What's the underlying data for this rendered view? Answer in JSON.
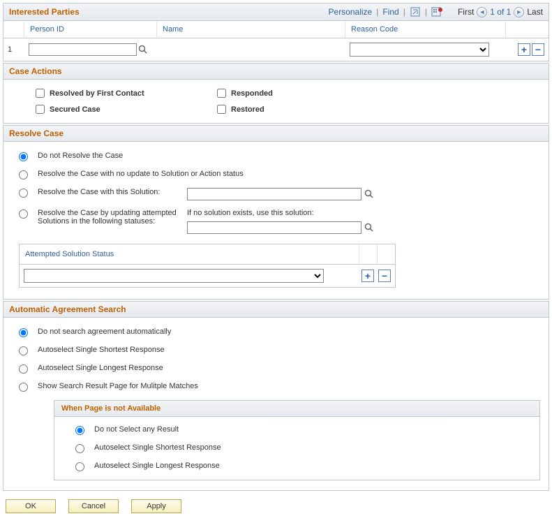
{
  "interestedParties": {
    "title": "Interested Parties",
    "tools": {
      "personalize": "Personalize",
      "find": "Find"
    },
    "nav": {
      "first": "First",
      "count": "1 of 1",
      "last": "Last"
    },
    "columns": {
      "personId": "Person ID",
      "name": "Name",
      "reasonCode": "Reason Code"
    },
    "row": {
      "num": "1",
      "personId": "",
      "name": "",
      "reasonCode": ""
    }
  },
  "caseActions": {
    "title": "Case Actions",
    "opts": {
      "resolvedFirstContact": "Resolved by First Contact",
      "responded": "Responded",
      "securedCase": "Secured Case",
      "restored": "Restored"
    }
  },
  "resolveCase": {
    "title": "Resolve Case",
    "opt1": "Do not Resolve the Case",
    "opt2": "Resolve the Case with no update to Solution or Action status",
    "opt3": "Resolve the Case with this Solution:",
    "opt3Value": "",
    "opt4": "Resolve the Case by updating attempted Solutions in the following statuses:",
    "opt4Hint": "If no solution exists, use this solution:",
    "opt4Value": "",
    "attemptedTable": {
      "header": "Attempted Solution Status",
      "value": ""
    }
  },
  "agreementSearch": {
    "title": "Automatic Agreement Search",
    "opt1": "Do not search agreement automatically",
    "opt2": "Autoselect Single Shortest Response",
    "opt3": "Autoselect Single Longest Response",
    "opt4": "Show Search Result Page for Mulitple Matches",
    "sub": {
      "title": "When Page is not Available",
      "opt1": "Do not Select any Result",
      "opt2": "Autoselect Single Shortest Response",
      "opt3": "Autoselect Single Longest Response"
    }
  },
  "buttons": {
    "ok": "OK",
    "cancel": "Cancel",
    "apply": "Apply"
  }
}
